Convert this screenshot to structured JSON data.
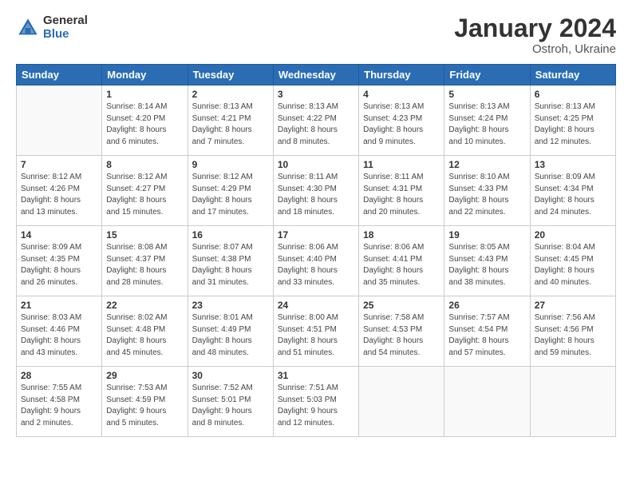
{
  "header": {
    "logo_general": "General",
    "logo_blue": "Blue",
    "title": "January 2024",
    "subtitle": "Ostroh, Ukraine"
  },
  "weekdays": [
    "Sunday",
    "Monday",
    "Tuesday",
    "Wednesday",
    "Thursday",
    "Friday",
    "Saturday"
  ],
  "weeks": [
    [
      {
        "day": "",
        "info": ""
      },
      {
        "day": "1",
        "info": "Sunrise: 8:14 AM\nSunset: 4:20 PM\nDaylight: 8 hours\nand 6 minutes."
      },
      {
        "day": "2",
        "info": "Sunrise: 8:13 AM\nSunset: 4:21 PM\nDaylight: 8 hours\nand 7 minutes."
      },
      {
        "day": "3",
        "info": "Sunrise: 8:13 AM\nSunset: 4:22 PM\nDaylight: 8 hours\nand 8 minutes."
      },
      {
        "day": "4",
        "info": "Sunrise: 8:13 AM\nSunset: 4:23 PM\nDaylight: 8 hours\nand 9 minutes."
      },
      {
        "day": "5",
        "info": "Sunrise: 8:13 AM\nSunset: 4:24 PM\nDaylight: 8 hours\nand 10 minutes."
      },
      {
        "day": "6",
        "info": "Sunrise: 8:13 AM\nSunset: 4:25 PM\nDaylight: 8 hours\nand 12 minutes."
      }
    ],
    [
      {
        "day": "7",
        "info": "Sunrise: 8:12 AM\nSunset: 4:26 PM\nDaylight: 8 hours\nand 13 minutes."
      },
      {
        "day": "8",
        "info": "Sunrise: 8:12 AM\nSunset: 4:27 PM\nDaylight: 8 hours\nand 15 minutes."
      },
      {
        "day": "9",
        "info": "Sunrise: 8:12 AM\nSunset: 4:29 PM\nDaylight: 8 hours\nand 17 minutes."
      },
      {
        "day": "10",
        "info": "Sunrise: 8:11 AM\nSunset: 4:30 PM\nDaylight: 8 hours\nand 18 minutes."
      },
      {
        "day": "11",
        "info": "Sunrise: 8:11 AM\nSunset: 4:31 PM\nDaylight: 8 hours\nand 20 minutes."
      },
      {
        "day": "12",
        "info": "Sunrise: 8:10 AM\nSunset: 4:33 PM\nDaylight: 8 hours\nand 22 minutes."
      },
      {
        "day": "13",
        "info": "Sunrise: 8:09 AM\nSunset: 4:34 PM\nDaylight: 8 hours\nand 24 minutes."
      }
    ],
    [
      {
        "day": "14",
        "info": "Sunrise: 8:09 AM\nSunset: 4:35 PM\nDaylight: 8 hours\nand 26 minutes."
      },
      {
        "day": "15",
        "info": "Sunrise: 8:08 AM\nSunset: 4:37 PM\nDaylight: 8 hours\nand 28 minutes."
      },
      {
        "day": "16",
        "info": "Sunrise: 8:07 AM\nSunset: 4:38 PM\nDaylight: 8 hours\nand 31 minutes."
      },
      {
        "day": "17",
        "info": "Sunrise: 8:06 AM\nSunset: 4:40 PM\nDaylight: 8 hours\nand 33 minutes."
      },
      {
        "day": "18",
        "info": "Sunrise: 8:06 AM\nSunset: 4:41 PM\nDaylight: 8 hours\nand 35 minutes."
      },
      {
        "day": "19",
        "info": "Sunrise: 8:05 AM\nSunset: 4:43 PM\nDaylight: 8 hours\nand 38 minutes."
      },
      {
        "day": "20",
        "info": "Sunrise: 8:04 AM\nSunset: 4:45 PM\nDaylight: 8 hours\nand 40 minutes."
      }
    ],
    [
      {
        "day": "21",
        "info": "Sunrise: 8:03 AM\nSunset: 4:46 PM\nDaylight: 8 hours\nand 43 minutes."
      },
      {
        "day": "22",
        "info": "Sunrise: 8:02 AM\nSunset: 4:48 PM\nDaylight: 8 hours\nand 45 minutes."
      },
      {
        "day": "23",
        "info": "Sunrise: 8:01 AM\nSunset: 4:49 PM\nDaylight: 8 hours\nand 48 minutes."
      },
      {
        "day": "24",
        "info": "Sunrise: 8:00 AM\nSunset: 4:51 PM\nDaylight: 8 hours\nand 51 minutes."
      },
      {
        "day": "25",
        "info": "Sunrise: 7:58 AM\nSunset: 4:53 PM\nDaylight: 8 hours\nand 54 minutes."
      },
      {
        "day": "26",
        "info": "Sunrise: 7:57 AM\nSunset: 4:54 PM\nDaylight: 8 hours\nand 57 minutes."
      },
      {
        "day": "27",
        "info": "Sunrise: 7:56 AM\nSunset: 4:56 PM\nDaylight: 8 hours\nand 59 minutes."
      }
    ],
    [
      {
        "day": "28",
        "info": "Sunrise: 7:55 AM\nSunset: 4:58 PM\nDaylight: 9 hours\nand 2 minutes."
      },
      {
        "day": "29",
        "info": "Sunrise: 7:53 AM\nSunset: 4:59 PM\nDaylight: 9 hours\nand 5 minutes."
      },
      {
        "day": "30",
        "info": "Sunrise: 7:52 AM\nSunset: 5:01 PM\nDaylight: 9 hours\nand 8 minutes."
      },
      {
        "day": "31",
        "info": "Sunrise: 7:51 AM\nSunset: 5:03 PM\nDaylight: 9 hours\nand 12 minutes."
      },
      {
        "day": "",
        "info": ""
      },
      {
        "day": "",
        "info": ""
      },
      {
        "day": "",
        "info": ""
      }
    ]
  ]
}
